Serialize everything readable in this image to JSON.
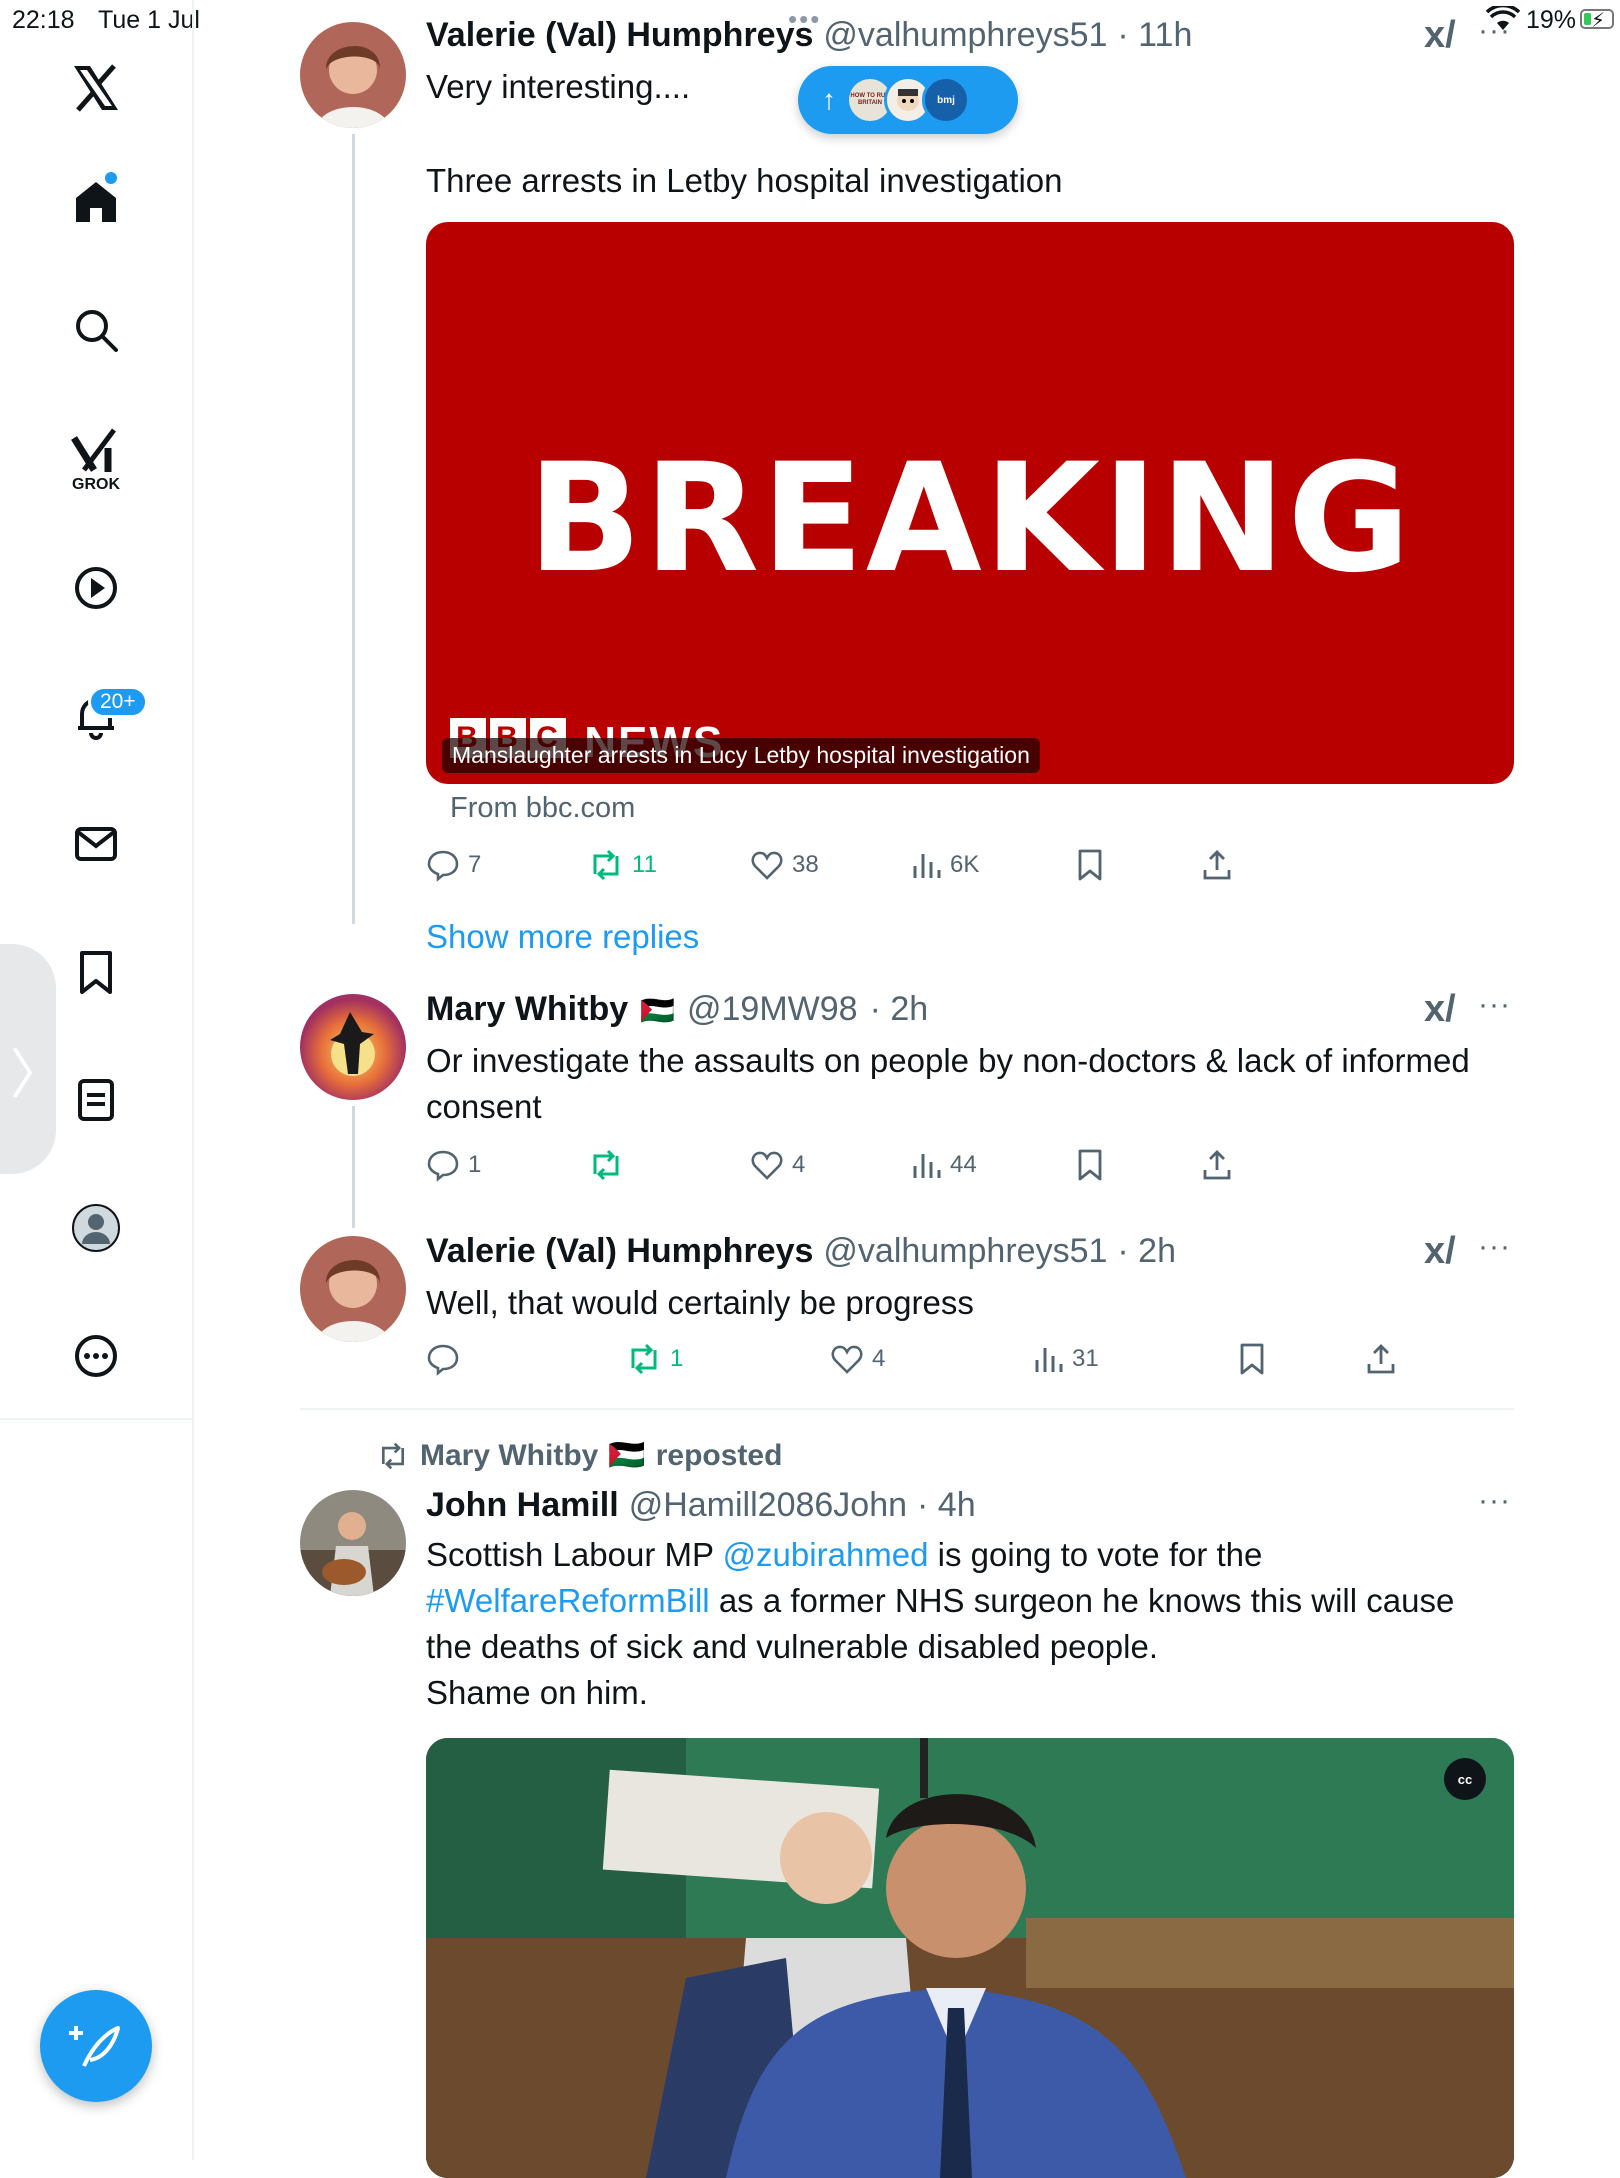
{
  "status_bar": {
    "time": "22:18",
    "date": "Tue 1 Jul",
    "battery": "19%"
  },
  "sidebar": {
    "grok_label": "GROK",
    "notifications_badge": "20+",
    "items": [
      {
        "icon": "x-logo-icon"
      },
      {
        "icon": "home-icon"
      },
      {
        "icon": "search-icon"
      },
      {
        "icon": "grok-icon"
      },
      {
        "icon": "video-icon"
      },
      {
        "icon": "bell-icon"
      },
      {
        "icon": "mail-icon"
      },
      {
        "icon": "bookmark-icon"
      },
      {
        "icon": "lists-icon"
      },
      {
        "icon": "profile-icon"
      },
      {
        "icon": "more-icon"
      }
    ]
  },
  "new_posts_pill": {
    "arrow": "↑",
    "avatar_1_text": "HOW TO RUN BRITAIN",
    "avatar_2_text": "bmj"
  },
  "tweets": [
    {
      "name": "Valerie (Val) Humphreys",
      "handle": "@valhumphreys51",
      "time": "· 11h",
      "text_1": "Very interesting....",
      "text_2": "Three arrests in Letby hospital investigation",
      "card": {
        "headline": "BREAKING",
        "logo": "NEWS",
        "caption": "Manslaughter arrests in Lucy Letby hospital investigation",
        "source": "From bbc.com"
      },
      "replies": "7",
      "reposts": "11",
      "likes": "38",
      "views": "6K"
    },
    {
      "name": "Mary Whitby",
      "flag": "🇵🇸",
      "handle": "@19MW98",
      "time": "· 2h",
      "text": "Or investigate the assaults on people by non-doctors & lack of informed consent",
      "replies": "1",
      "reposts": "",
      "likes": "4",
      "views": "44"
    },
    {
      "name": "Valerie (Val) Humphreys",
      "handle": "@valhumphreys51",
      "time": "· 2h",
      "text": "Well, that would certainly be progress",
      "replies": "",
      "reposts": "1",
      "likes": "4",
      "views": "31"
    },
    {
      "reposted_by": "Mary Whitby",
      "reposted_flag": "🇵🇸",
      "reposted_label": "reposted",
      "name": "John Hamill",
      "handle": "@Hamill2086John",
      "time": "· 4h",
      "text_a": "Scottish Labour MP ",
      "mention": "@zubirahmed",
      "text_b": " is going to vote for the",
      "hashtag": "#WelfareReformBill",
      "text_c": " as a former NHS surgeon he knows this will cause the deaths of sick and vulnerable disabled people.",
      "text_d": "Shame on him.",
      "video_badge": "cc"
    }
  ],
  "show_more_replies": "Show more replies",
  "colors": {
    "accent": "#1d9bf0",
    "repost_green": "#00ba7c",
    "bbc_red": "#b80000",
    "muted": "#536471"
  }
}
